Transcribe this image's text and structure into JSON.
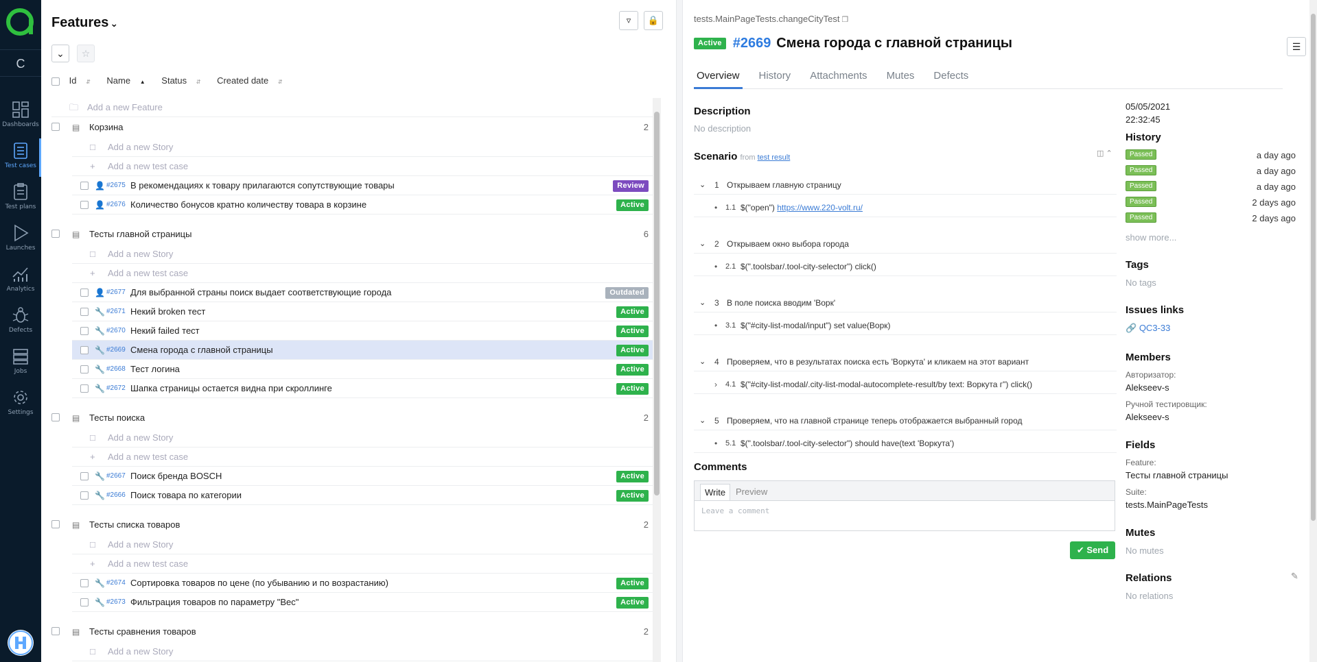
{
  "nav": {
    "project_letter": "C",
    "items": [
      {
        "label": "Dashboards"
      },
      {
        "label": "Test cases"
      },
      {
        "label": "Test plans"
      },
      {
        "label": "Launches"
      },
      {
        "label": "Analytics"
      },
      {
        "label": "Defects"
      },
      {
        "label": "Jobs"
      },
      {
        "label": "Settings"
      }
    ]
  },
  "tree": {
    "title": "Features",
    "columns": [
      "Id",
      "Name",
      "Status",
      "Created date"
    ],
    "add_feature": "Add a new Feature",
    "add_story": "Add a new Story",
    "add_test": "Add a new test case",
    "groups": [
      {
        "name": "Корзина",
        "count": "2",
        "cases": [
          {
            "id": "#2675",
            "name": "В рекомендациях к товару прилагаются сопутствующие товары",
            "status": "Review"
          },
          {
            "id": "#2676",
            "name": "Количество бонусов кратно количеству товара в корзине",
            "status": "Active"
          }
        ]
      },
      {
        "name": "Тесты главной страницы",
        "count": "6",
        "cases": [
          {
            "id": "#2677",
            "name": "Для выбранной страны поиск выдает соответствующие города",
            "status": "Outdated"
          },
          {
            "id": "#2671",
            "name": "Некий broken тест",
            "status": "Active"
          },
          {
            "id": "#2670",
            "name": "Некий failed тест",
            "status": "Active"
          },
          {
            "id": "#2669",
            "name": "Смена города с главной страницы",
            "status": "Active"
          },
          {
            "id": "#2668",
            "name": "Тест логина",
            "status": "Active"
          },
          {
            "id": "#2672",
            "name": "Шапка страницы остается видна при скроллинге",
            "status": "Active"
          }
        ]
      },
      {
        "name": "Тесты поиска",
        "count": "2",
        "cases": [
          {
            "id": "#2667",
            "name": "Поиск бренда BOSCH",
            "status": "Active"
          },
          {
            "id": "#2666",
            "name": "Поиск товара по категории",
            "status": "Active"
          }
        ]
      },
      {
        "name": "Тесты списка товаров",
        "count": "2",
        "cases": [
          {
            "id": "#2674",
            "name": "Сортировка товаров по цене (по убыванию и по возрастанию)",
            "status": "Active"
          },
          {
            "id": "#2673",
            "name": "Фильтрация товаров по параметру \"Вес\"",
            "status": "Active"
          }
        ]
      },
      {
        "name": "Тесты сравнения товаров",
        "count": "2",
        "cases": []
      }
    ]
  },
  "detail": {
    "breadcrumb": "tests.MainPageTests.changeCityTest",
    "status": "Active",
    "id": "#2669",
    "name": "Смена города с главной страницы",
    "tabs": [
      "Overview",
      "History",
      "Attachments",
      "Mutes",
      "Defects"
    ],
    "description_title": "Description",
    "description": "No description",
    "scenario_title": "Scenario",
    "scenario_from": "from",
    "scenario_link": "test result",
    "steps": [
      {
        "num": "1",
        "text": "Открываем главную страницу",
        "sub": {
          "num": "1.1",
          "text": "$(\"open\")",
          "link": "https://www.220-volt.ru/"
        }
      },
      {
        "num": "2",
        "text": "Открываем окно выбора города",
        "sub": {
          "num": "2.1",
          "text": "$(\".toolsbar/.tool-city-selector\") click()"
        }
      },
      {
        "num": "3",
        "text": "В поле поиска вводим 'Ворк'",
        "sub": {
          "num": "3.1",
          "text": "$(\"#city-list-modal/input\") set value(Ворк)"
        }
      },
      {
        "num": "4",
        "text": "Проверяем, что в результатах поиска есть 'Воркута' и кликаем на этот вариант",
        "sub": {
          "num": "4.1",
          "text": "$(\"#city-list-modal/.city-list-modal-autocomplete-result/by text: Воркута г\") click()"
        }
      },
      {
        "num": "5",
        "text": "Проверяем, что на главной странице теперь отображается выбранный город",
        "sub": {
          "num": "5.1",
          "text": "$(\".toolsbar/.tool-city-selector\") should have(text 'Воркута')"
        }
      }
    ],
    "comments_title": "Comments",
    "comment_tabs": [
      "Write",
      "Preview"
    ],
    "comment_placeholder": "Leave a comment",
    "send_label": "Send",
    "side": {
      "date": "05/05/2021",
      "time": "22:32:45",
      "history_title": "History",
      "history": [
        {
          "status": "Passed",
          "when": "a day ago"
        },
        {
          "status": "Passed",
          "when": "a day ago"
        },
        {
          "status": "Passed",
          "when": "a day ago"
        },
        {
          "status": "Passed",
          "when": "2 days ago"
        },
        {
          "status": "Passed",
          "when": "2 days ago"
        }
      ],
      "show_more": "show more...",
      "tags_title": "Tags",
      "tags_empty": "No tags",
      "issues_title": "Issues links",
      "issue": "QC3-33",
      "members_title": "Members",
      "member1_role": "Авторизатор:",
      "member1_name": "Alekseev-s",
      "member2_role": "Ручной тестировщик:",
      "member2_name": "Alekseev-s",
      "fields_title": "Fields",
      "field1_label": "Feature:",
      "field1_value": "Тесты главной страницы",
      "field2_label": "Suite:",
      "field2_value": "tests.MainPageTests",
      "mutes_title": "Mutes",
      "mutes_empty": "No mutes",
      "relations_title": "Relations",
      "relations_empty": "No relations"
    }
  },
  "colors": {
    "nav_bg": "#0a1b2b",
    "active": "#2eb24c",
    "review": "#7c4bbf",
    "outdated": "#a9b2bc",
    "link": "#3a7bd5",
    "passed": "#7bbf57"
  }
}
